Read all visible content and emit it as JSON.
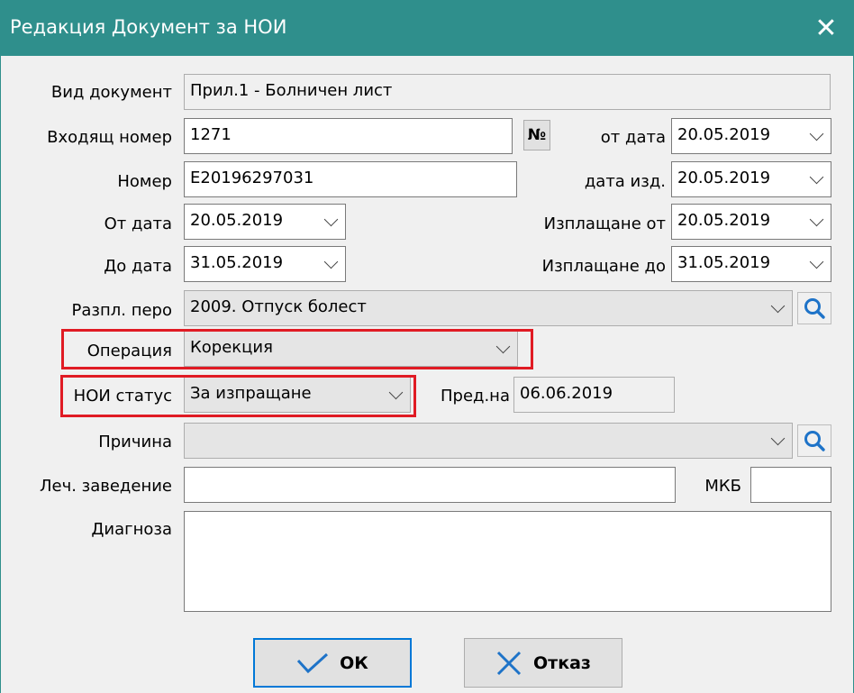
{
  "window": {
    "title": "Редакция Документ за НОИ",
    "close_icon": "✕"
  },
  "form": {
    "vid_dokument": {
      "label": "Вид документ",
      "value": "Прил.1 - Болничен лист"
    },
    "vhodyasht_nomer": {
      "label": "Входящ номер",
      "value": "1271",
      "number_button": "№"
    },
    "ot_data_top": {
      "label": "от дата",
      "value": "20.05.2019"
    },
    "nomer": {
      "label": "Номер",
      "value": "E20196297031"
    },
    "data_izd": {
      "label": "дата изд.",
      "value": "20.05.2019"
    },
    "ot_data": {
      "label": "От дата",
      "value": "20.05.2019"
    },
    "izplashtane_ot": {
      "label": "Изплащане от",
      "value": "20.05.2019"
    },
    "do_data": {
      "label": "До дата",
      "value": "31.05.2019"
    },
    "izplashtane_do": {
      "label": "Изплащане до",
      "value": "31.05.2019"
    },
    "razpl_pero": {
      "label": "Разпл. перо",
      "value": "2009. Отпуск болест"
    },
    "operaciya": {
      "label": "Операция",
      "value": "Корекция"
    },
    "noi_status": {
      "label": "НОИ статус",
      "value": "За изпращане"
    },
    "pred_na": {
      "label": "Пред.на",
      "value": "06.06.2019"
    },
    "prichina": {
      "label": "Причина",
      "value": ""
    },
    "lech_zavedenie": {
      "label": "Леч. заведение",
      "value": ""
    },
    "mkb": {
      "label": "МКБ",
      "value": ""
    },
    "diagnoza": {
      "label": "Диагноза",
      "value": ""
    }
  },
  "buttons": {
    "ok": "ОК",
    "cancel": "Отказ"
  },
  "colors": {
    "titlebar": "#2f8f8c",
    "highlight": "#e01b24",
    "default_button_border": "#0078d7",
    "search_icon": "#1e73c8"
  }
}
